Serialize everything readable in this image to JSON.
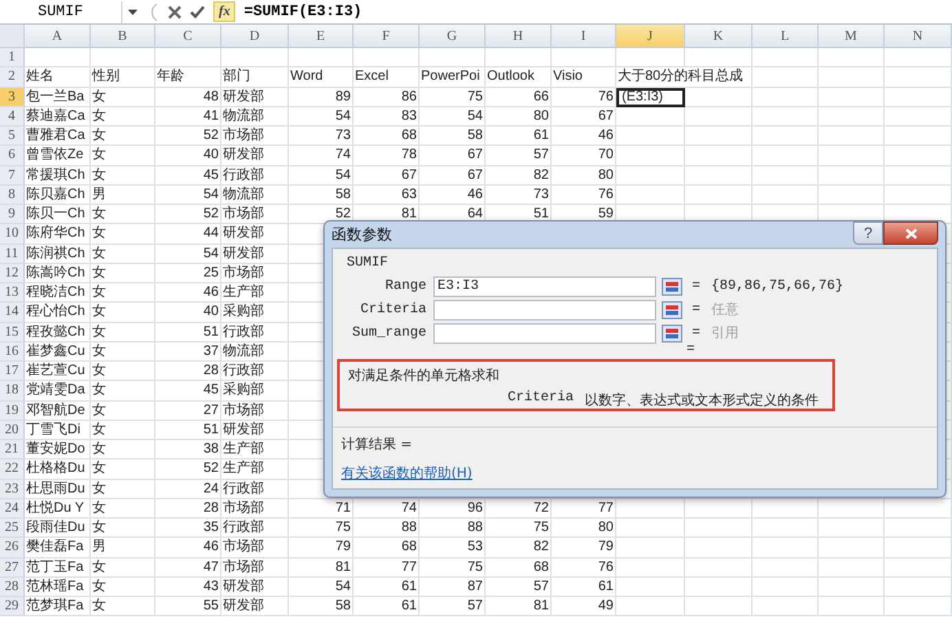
{
  "formula_bar": {
    "name_box": "SUMIF",
    "function_button": "fx",
    "formula": "=SUMIF(E3:I3)"
  },
  "sheet": {
    "columns": [
      {
        "label": "A",
        "selected": false
      },
      {
        "label": "B",
        "selected": false
      },
      {
        "label": "C",
        "selected": false
      },
      {
        "label": "D",
        "selected": false
      },
      {
        "label": "E",
        "selected": false
      },
      {
        "label": "F",
        "selected": false
      },
      {
        "label": "G",
        "selected": false
      },
      {
        "label": "H",
        "selected": false
      },
      {
        "label": "I",
        "selected": false
      },
      {
        "label": "J",
        "selected": true
      },
      {
        "label": "K",
        "selected": false
      },
      {
        "label": "L",
        "selected": false
      },
      {
        "label": "M",
        "selected": false
      },
      {
        "label": "N",
        "selected": false
      }
    ],
    "rows": [
      {
        "number": "1",
        "kind": "header",
        "selected": false,
        "cells": []
      },
      {
        "number": "2",
        "kind": "header",
        "selected": false,
        "cells": [
          "姓名",
          "性别",
          "年龄",
          "部门",
          "Word",
          "Excel",
          "PowerPoi",
          "Outlook",
          "Visio",
          "大于80分的科目总成"
        ]
      },
      {
        "number": "3",
        "kind": "data",
        "selected": true,
        "cells": [
          "包一兰Ba",
          "女",
          "48",
          "研发部",
          "89",
          "86",
          "75",
          "66",
          "76",
          "(E3:I3)"
        ]
      },
      {
        "number": "4",
        "kind": "data",
        "selected": false,
        "cells": [
          "蔡迪嘉Ca",
          "女",
          "41",
          "物流部",
          "54",
          "83",
          "54",
          "80",
          "67"
        ]
      },
      {
        "number": "5",
        "kind": "data",
        "selected": false,
        "cells": [
          "曹雅君Ca",
          "女",
          "52",
          "市场部",
          "73",
          "68",
          "58",
          "61",
          "46"
        ]
      },
      {
        "number": "6",
        "kind": "data",
        "selected": false,
        "cells": [
          "曾雪依Ze",
          "女",
          "40",
          "研发部",
          "74",
          "78",
          "67",
          "57",
          "70"
        ]
      },
      {
        "number": "7",
        "kind": "data",
        "selected": false,
        "cells": [
          "常援琪Ch",
          "女",
          "45",
          "行政部",
          "54",
          "67",
          "67",
          "82",
          "80"
        ]
      },
      {
        "number": "8",
        "kind": "data",
        "selected": false,
        "cells": [
          "陈贝嘉Ch",
          "男",
          "54",
          "物流部",
          "58",
          "63",
          "46",
          "73",
          "76"
        ]
      },
      {
        "number": "9",
        "kind": "data",
        "selected": false,
        "cells": [
          "陈贝一Ch",
          "女",
          "52",
          "市场部",
          "52",
          "81",
          "64",
          "51",
          "59"
        ]
      },
      {
        "number": "10",
        "kind": "data",
        "selected": false,
        "cells": [
          "陈府华Ch",
          "女",
          "44",
          "研发部"
        ]
      },
      {
        "number": "11",
        "kind": "data",
        "selected": false,
        "cells": [
          "陈润祺Ch",
          "女",
          "54",
          "研发部"
        ]
      },
      {
        "number": "12",
        "kind": "data",
        "selected": false,
        "cells": [
          "陈嵩吟Ch",
          "女",
          "25",
          "市场部"
        ]
      },
      {
        "number": "13",
        "kind": "data",
        "selected": false,
        "cells": [
          "程晓洁Ch",
          "女",
          "46",
          "生产部"
        ]
      },
      {
        "number": "14",
        "kind": "data",
        "selected": false,
        "cells": [
          "程心怡Ch",
          "女",
          "40",
          "采购部"
        ]
      },
      {
        "number": "15",
        "kind": "data",
        "selected": false,
        "cells": [
          "程孜懿Ch",
          "女",
          "51",
          "行政部"
        ]
      },
      {
        "number": "16",
        "kind": "data",
        "selected": false,
        "cells": [
          "崔梦鑫Cu",
          "女",
          "37",
          "物流部"
        ]
      },
      {
        "number": "17",
        "kind": "data",
        "selected": false,
        "cells": [
          "崔艺萱Cu",
          "女",
          "28",
          "行政部"
        ]
      },
      {
        "number": "18",
        "kind": "data",
        "selected": false,
        "cells": [
          "党靖雯Da",
          "女",
          "45",
          "采购部"
        ]
      },
      {
        "number": "19",
        "kind": "data",
        "selected": false,
        "cells": [
          "邓智航De",
          "女",
          "27",
          "市场部"
        ]
      },
      {
        "number": "20",
        "kind": "data",
        "selected": false,
        "cells": [
          "丁雪飞Di",
          "女",
          "51",
          "研发部"
        ]
      },
      {
        "number": "21",
        "kind": "data",
        "selected": false,
        "cells": [
          "董安妮Do",
          "女",
          "38",
          "生产部"
        ]
      },
      {
        "number": "22",
        "kind": "data",
        "selected": false,
        "cells": [
          "杜格格Du",
          "女",
          "52",
          "生产部"
        ]
      },
      {
        "number": "23",
        "kind": "data",
        "selected": false,
        "cells": [
          "杜思雨Du",
          "女",
          "24",
          "行政部"
        ]
      },
      {
        "number": "24",
        "kind": "data",
        "selected": false,
        "cells": [
          "杜悦Du Y",
          "女",
          "28",
          "市场部",
          "71",
          "74",
          "96",
          "72",
          "77"
        ]
      },
      {
        "number": "25",
        "kind": "data",
        "selected": false,
        "cells": [
          "段雨佳Du",
          "女",
          "35",
          "行政部",
          "75",
          "88",
          "88",
          "75",
          "80"
        ]
      },
      {
        "number": "26",
        "kind": "data",
        "selected": false,
        "cells": [
          "樊佳磊Fa",
          "男",
          "46",
          "市场部",
          "79",
          "68",
          "53",
          "82",
          "79"
        ]
      },
      {
        "number": "27",
        "kind": "data",
        "selected": false,
        "cells": [
          "范丁玉Fa",
          "女",
          "47",
          "市场部",
          "81",
          "77",
          "75",
          "68",
          "76"
        ]
      },
      {
        "number": "28",
        "kind": "data",
        "selected": false,
        "cells": [
          "范林瑶Fa",
          "女",
          "43",
          "研发部",
          "54",
          "61",
          "87",
          "57",
          "61"
        ]
      },
      {
        "number": "29",
        "kind": "data",
        "selected": false,
        "cells": [
          "范梦琪Fa",
          "女",
          "55",
          "研发部",
          "58",
          "61",
          "57",
          "81",
          "49"
        ]
      }
    ]
  },
  "dialog": {
    "title": "函数参数",
    "help_button": "?",
    "function_name": "SUMIF",
    "arguments": [
      {
        "label": "Range",
        "value": "E3:I3",
        "result": "{89,86,75,66,76}",
        "muted": false
      },
      {
        "label": "Criteria",
        "result": "任意",
        "muted": true
      },
      {
        "label": "Sum_range",
        "result": "引用",
        "muted": true
      }
    ],
    "formula_result_sign": "=",
    "description": "对满足条件的单元格求和",
    "argument_name": "Criteria",
    "argument_help": "以数字、表达式或文本形式定义的条件",
    "result_label": "计算结果 =",
    "help_link": "有关该函数的帮助(H)"
  }
}
